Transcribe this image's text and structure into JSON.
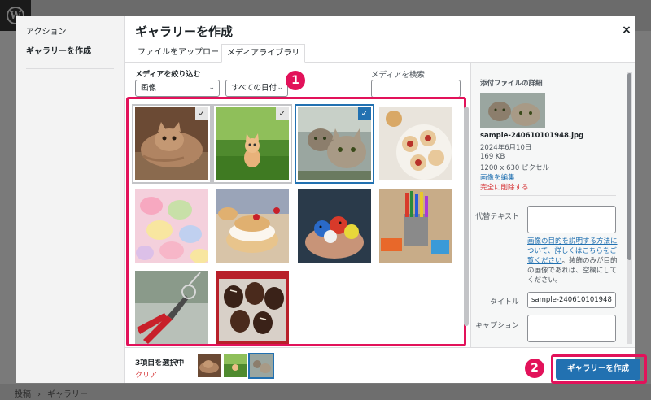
{
  "modal": {
    "title": "ギャラリーを作成",
    "close_label": "×"
  },
  "menu": {
    "heading": "アクション",
    "items": [
      {
        "label": "ギャラリーを作成"
      }
    ]
  },
  "tabs": [
    {
      "label": "ファイルをアップロード"
    },
    {
      "label": "メディアライブラリ"
    }
  ],
  "filters": {
    "label": "メディアを絞り込む",
    "type_value": "画像",
    "date_value": "すべての日付",
    "search_label": "メディアを検索"
  },
  "icons": {
    "checkmark": "✓",
    "chevron": "⌄"
  },
  "callouts": [
    "1",
    "2"
  ],
  "gallery": [
    {
      "subject": "cat-lying-on-carpet",
      "state": "selected"
    },
    {
      "subject": "kitten-on-grass",
      "state": "selected"
    },
    {
      "subject": "two-tabby-cats",
      "state": "current"
    },
    {
      "subject": "cookies-on-plate",
      "state": "none"
    },
    {
      "subject": "heart-candies",
      "state": "none"
    },
    {
      "subject": "cream-puffs",
      "state": "none"
    },
    {
      "subject": "clay-birds-in-hand",
      "state": "none"
    },
    {
      "subject": "colored-pencils",
      "state": "none"
    },
    {
      "subject": "pliers-and-wire",
      "state": "none"
    },
    {
      "subject": "chocolate-strawberries",
      "state": "none"
    }
  ],
  "details": {
    "heading": "添付ファイルの詳細",
    "filename": "sample-240610101948.jpg",
    "date": "2024年6月10日",
    "size": "169 KB",
    "dimensions": "1200 x 630 ピクセル",
    "edit_link": "画像を編集",
    "delete_link": "完全に削除する",
    "alt_label": "代替テキスト",
    "help_link": "画像の目的を説明する方法について、詳しくはこちらをご覧ください",
    "help_text": "。装飾のみが目的の画像であれば、空欄にしてください。",
    "title_label": "タイトル",
    "title_value": "sample-240610101948",
    "caption_label": "キャプション"
  },
  "toolbar": {
    "selected_count": "3項目を選択中",
    "clear_label": "クリア",
    "create_button": "ギャラリーを作成"
  },
  "footer": {
    "breadcrumb": [
      "投稿",
      "ギャラリー"
    ],
    "separator": "›"
  },
  "colors": {
    "highlight": "#e2125a",
    "primary": "#2271b1",
    "danger": "#d63638"
  }
}
